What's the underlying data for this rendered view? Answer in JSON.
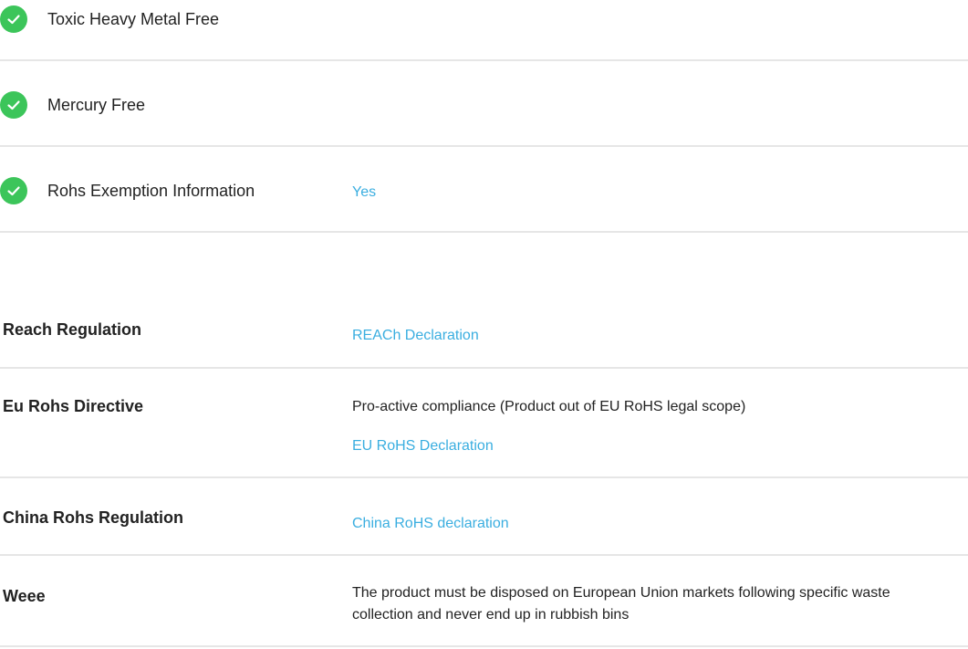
{
  "features": [
    {
      "label": "Toxic Heavy Metal Free",
      "icon": "check-circle-icon",
      "value": ""
    },
    {
      "label": "Mercury Free",
      "icon": "check-circle-icon",
      "value": ""
    },
    {
      "label": "Rohs Exemption Information",
      "icon": "check-circle-icon",
      "value": "Yes"
    }
  ],
  "regulations": {
    "reach": {
      "label": "Reach Regulation",
      "link": "REACh Declaration"
    },
    "eu_rohs": {
      "label": "Eu Rohs Directive",
      "text": "Pro-active compliance (Product out of EU RoHS legal scope)",
      "link": "EU RoHS Declaration"
    },
    "china_rohs": {
      "label": "China Rohs Regulation",
      "link": "China RoHS declaration"
    },
    "weee": {
      "label": "Weee",
      "text": "The product must be disposed on European Union markets following specific waste collection and never end up in rubbish bins"
    }
  },
  "colors": {
    "check": "#3cc55a",
    "link": "#3aaee0",
    "divider": "#e6e6e6"
  }
}
